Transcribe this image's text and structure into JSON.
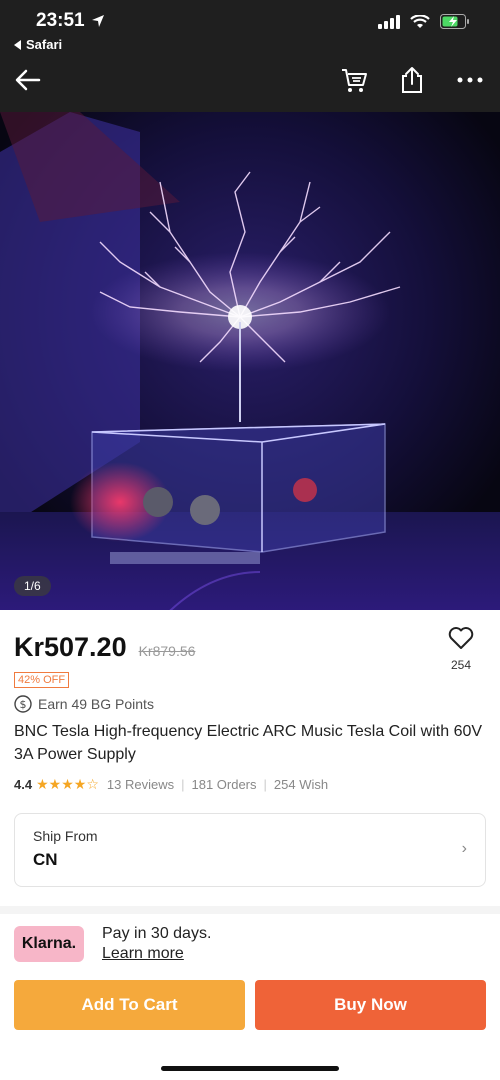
{
  "status_bar": {
    "time": "23:51",
    "back_app": "Safari"
  },
  "hero": {
    "page_indicator": "1/6"
  },
  "product": {
    "price": "Kr507.20",
    "old_price": "Kr879.56",
    "discount": "42% OFF",
    "points": "Earn 49 BG Points",
    "title": "BNC Tesla High-frequency Electric ARC Music Tesla Coil with 60V 3A Power Supply",
    "wish_count": "254"
  },
  "rating": {
    "score": "4.4",
    "stars": 4.4,
    "reviews": "13 Reviews",
    "orders": "181 Orders",
    "wish": "254 Wish"
  },
  "shipping": {
    "label": "Ship From",
    "value": "CN"
  },
  "klarna": {
    "logo": "Klarna.",
    "line1": "Pay in 30 days.",
    "link": "Learn more"
  },
  "actions": {
    "add_to_cart": "Add To Cart",
    "buy_now": "Buy Now"
  },
  "colors": {
    "accent_orange": "#f07b3f",
    "cart_button": "#f5a93c",
    "buy_button": "#ef6338",
    "klarna_pink": "#f7b6c8",
    "star": "#f5a623"
  },
  "icons": [
    "location-arrow-icon",
    "back-chevron-icon",
    "signal-icon",
    "wifi-icon",
    "battery-icon",
    "back-arrow-icon",
    "cart-icon",
    "share-icon",
    "more-icon",
    "heart-icon",
    "dollar-circle-icon",
    "star-icon",
    "chevron-right-icon"
  ]
}
